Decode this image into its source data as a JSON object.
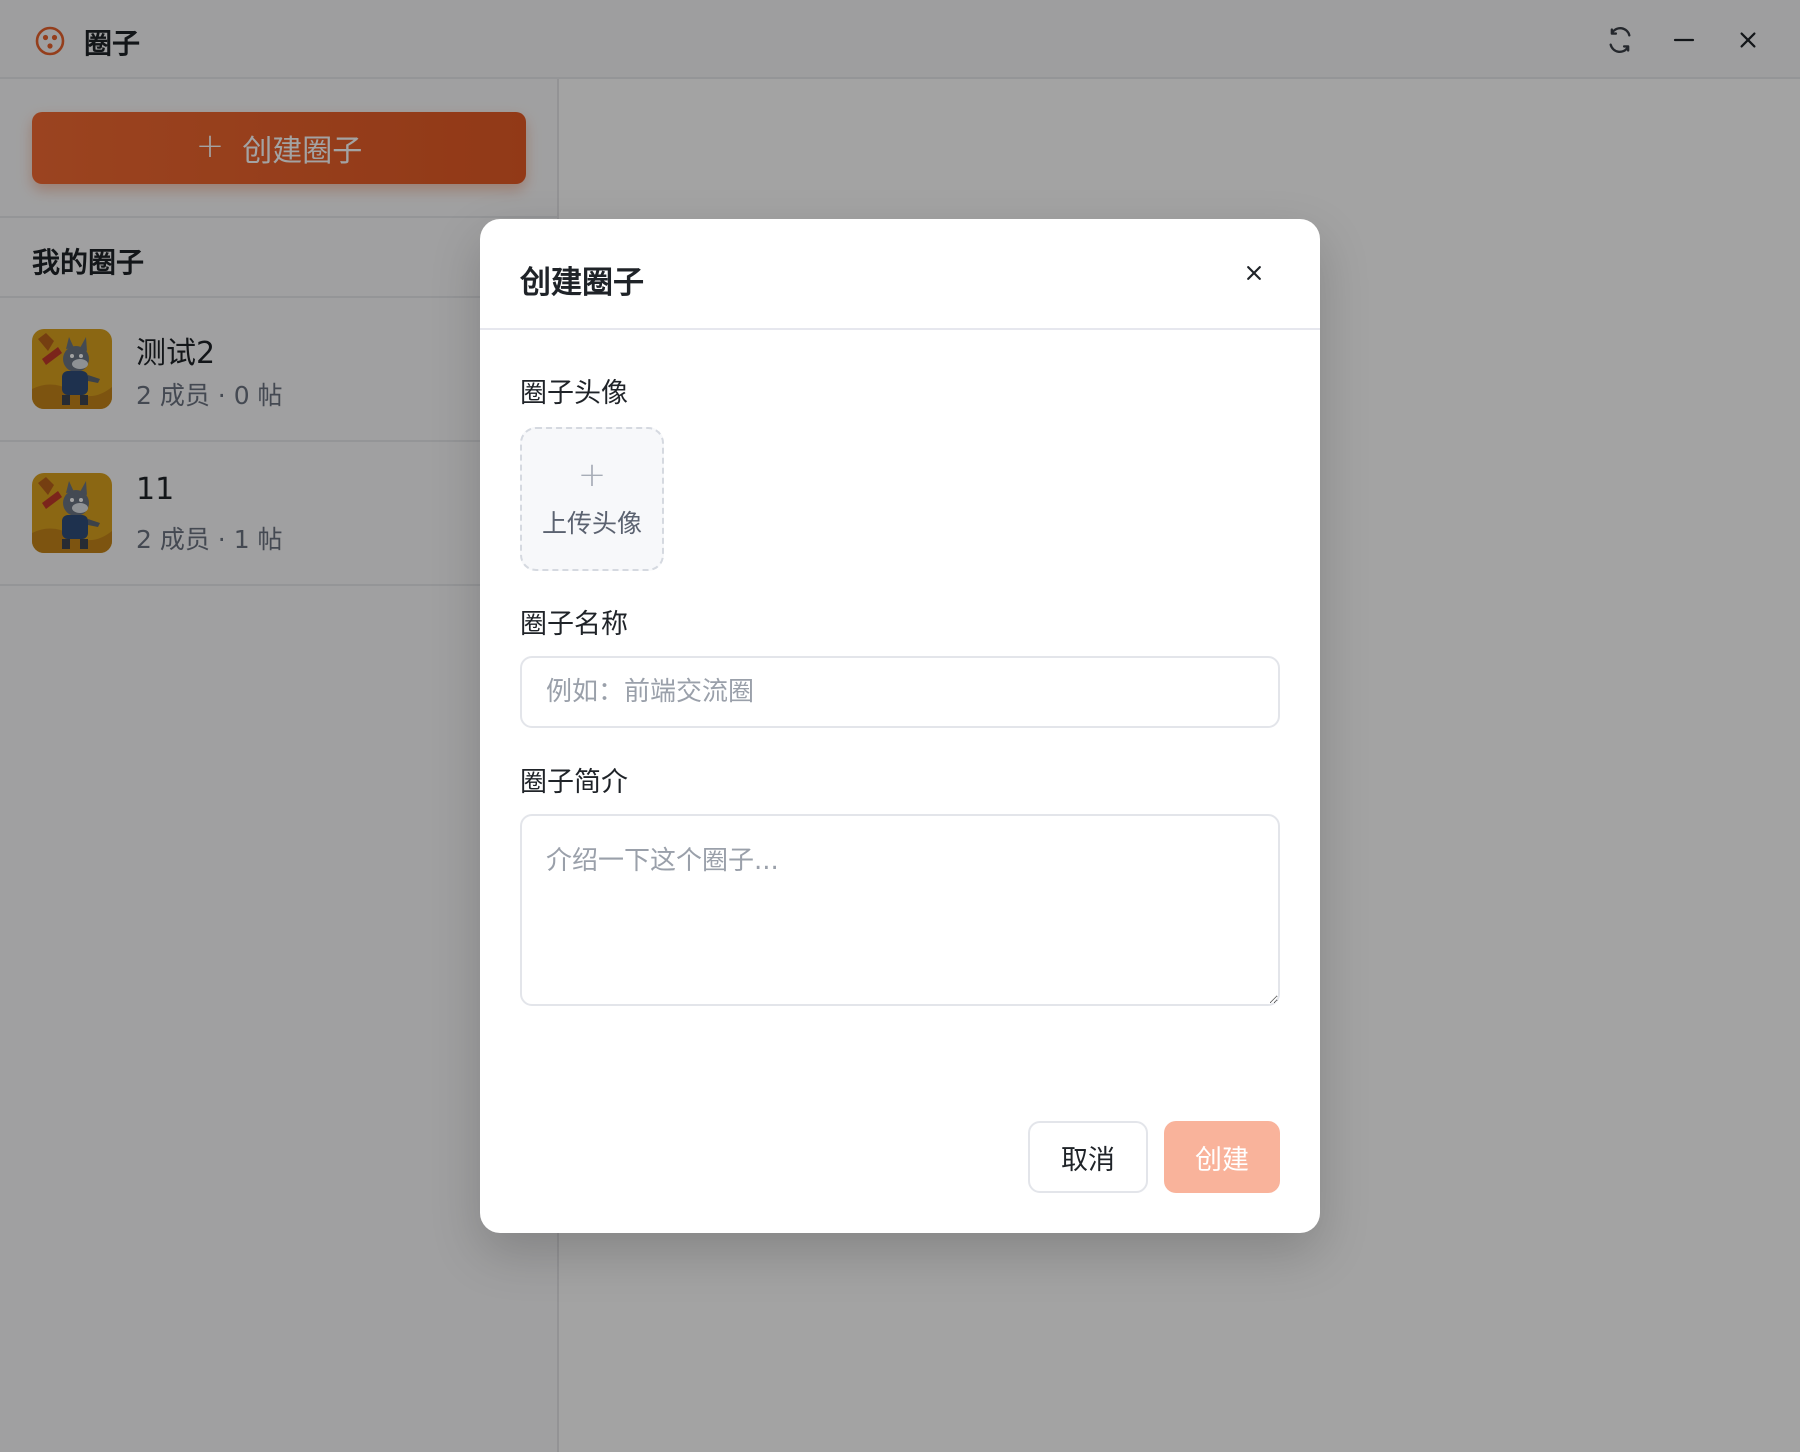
{
  "app": {
    "title": "圈子",
    "logo_icon": "circle-logo-icon",
    "accent_color": "#e8622c"
  },
  "window_controls": {
    "refresh_icon": "refresh-icon",
    "minimize_icon": "minimize-icon",
    "close_icon": "close-icon"
  },
  "sidebar": {
    "create_button_label": "创建圈子",
    "create_button_icon": "plus-icon",
    "section_title": "我的圈子",
    "circles": [
      {
        "name": "测试2",
        "meta": "2 成员 · 0 帖",
        "avatar_icon": "wolf-avatar-image"
      },
      {
        "name": "11",
        "meta": "2 成员 · 1 帖",
        "avatar_icon": "wolf-avatar-image"
      }
    ]
  },
  "modal": {
    "title": "创建圈子",
    "close_icon": "close-icon",
    "avatar_label": "圈子头像",
    "upload_plus": "+",
    "upload_label": "上传头像",
    "name_label": "圈子名称",
    "name_value": "",
    "name_placeholder": "例如：前端交流圈",
    "desc_label": "圈子简介",
    "desc_value": "",
    "desc_placeholder": "介绍一下这个圈子...",
    "cancel_label": "取消",
    "create_label": "创建",
    "create_color": "#f9b39b"
  }
}
